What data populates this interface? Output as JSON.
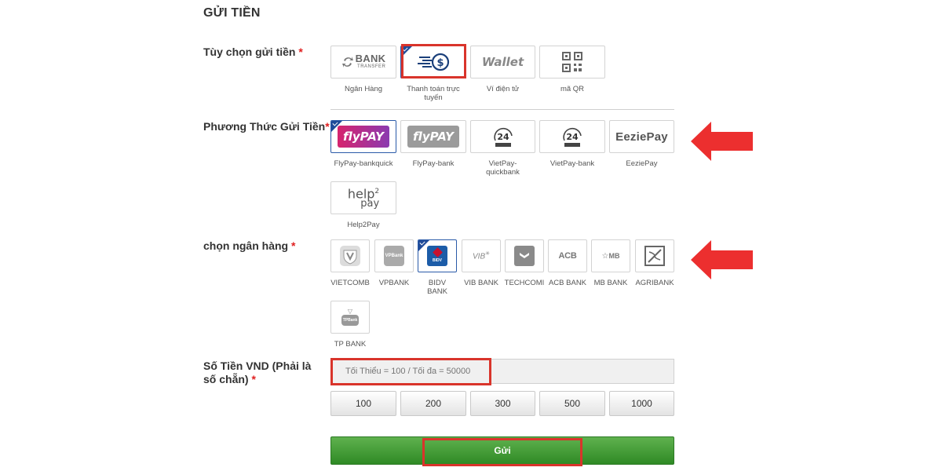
{
  "title": "GỬI TIỀN",
  "required_mark": "*",
  "labels": {
    "deposit_option": "Tùy chọn gửi tiền",
    "method": "Phương Thức Gửi Tiền",
    "bank": "chọn ngân hàng",
    "amount_line1": "Số Tiền VND (Phải là",
    "amount_line2": "số chẵn)"
  },
  "options": [
    {
      "caption": "Ngân Hàng",
      "logo_main": "BANK",
      "logo_sub": "TRANSFER",
      "icon": "bank-transfer-icon"
    },
    {
      "caption": "Thanh toán trực tuyến",
      "icon": "online-payment-icon",
      "selected": true
    },
    {
      "caption": "Ví điện tử",
      "logo_main": "Wallet",
      "icon": "wallet-icon"
    },
    {
      "caption": "mã QR",
      "icon": "qr-code-icon"
    }
  ],
  "methods": [
    {
      "caption": "FlyPay-bankquick",
      "logo": "flypay",
      "selected": true
    },
    {
      "caption": "FlyPay-bank",
      "logo": "flypay"
    },
    {
      "caption": "VietPay-quickbank",
      "logo": "24h"
    },
    {
      "caption": "VietPay-bank",
      "logo": "24h"
    },
    {
      "caption": "EeziePay",
      "logo": "EeziePay"
    },
    {
      "caption": "Help2Pay",
      "logo_a": "help",
      "logo_b": "2",
      "logo_c": "ay"
    }
  ],
  "banks": [
    {
      "caption": "VIETCOMB"
    },
    {
      "caption": "VPBANK",
      "logo": "VPBank"
    },
    {
      "caption": "BIDV BANK",
      "logo": "BIDV",
      "selected": true
    },
    {
      "caption": "VIB BANK",
      "logo": "VIB"
    },
    {
      "caption": "TECHCOMI"
    },
    {
      "caption": "ACB BANK",
      "logo": "ACB"
    },
    {
      "caption": "MB BANK",
      "logo": "MB"
    },
    {
      "caption": "AGRIBANK"
    },
    {
      "caption": "TP BANK",
      "logo": "TPBank"
    }
  ],
  "amount": {
    "placeholder": "Tối Thiểu = 100 / Tối đa = 50000",
    "presets": [
      "100",
      "200",
      "300",
      "500",
      "1000"
    ]
  },
  "submit_label": "Gửi",
  "colors": {
    "accent_red": "#d9342b",
    "select_blue": "#1f4b99",
    "submit_green": "#3f9a33",
    "flypay_pink": "#d6246e",
    "bidv_red": "#c8102e"
  }
}
